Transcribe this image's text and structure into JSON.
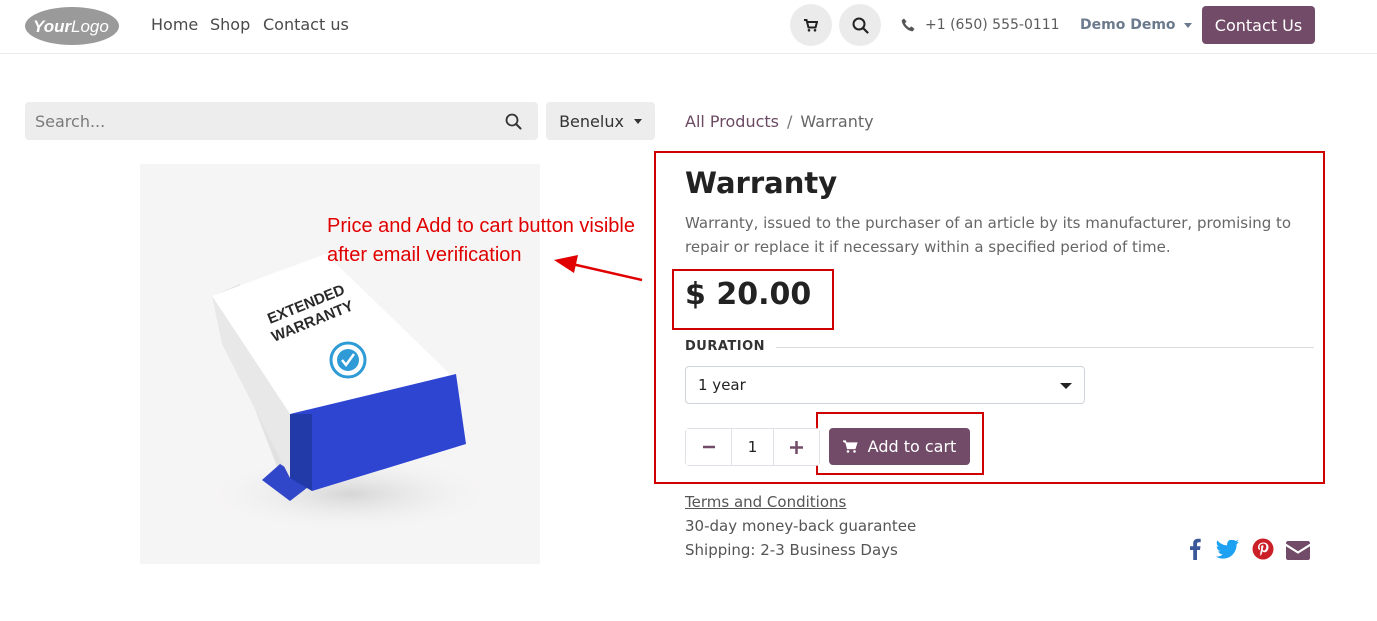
{
  "header": {
    "logo_text": "YourLogo",
    "nav": [
      "Home",
      "Shop",
      "Contact us"
    ],
    "phone": "+1 (650) 555-0111",
    "user": "Demo Demo",
    "contact_button": "Contact Us"
  },
  "search": {
    "placeholder": "Search...",
    "region": "Benelux"
  },
  "breadcrumb": {
    "parent": "All Products",
    "separator": "/",
    "current": "Warranty"
  },
  "product": {
    "title": "Warranty",
    "description": "Warranty, issued to the purchaser of an article by its manufacturer, promising to repair or replace it if necessary within a specified period of time.",
    "price": "$ 20.00",
    "attribute_label": "DURATION",
    "attribute_value": "1 year",
    "quantity": "1",
    "add_to_cart": "Add to cart",
    "box_text_line1": "EXTENDED",
    "box_text_line2": "WARRANTY"
  },
  "info": {
    "terms": "Terms and Conditions",
    "guarantee": "30-day money-back guarantee",
    "shipping": "Shipping: 2-3 Business Days"
  },
  "annotation": {
    "line1": "Price and Add to cart button visible",
    "line2": "after email verification"
  },
  "colors": {
    "brand": "#714b67",
    "annotation": "#e00000",
    "facebook": "#3b5998",
    "twitter": "#1da1f2",
    "pinterest": "#cb2027",
    "email": "#714b67"
  }
}
